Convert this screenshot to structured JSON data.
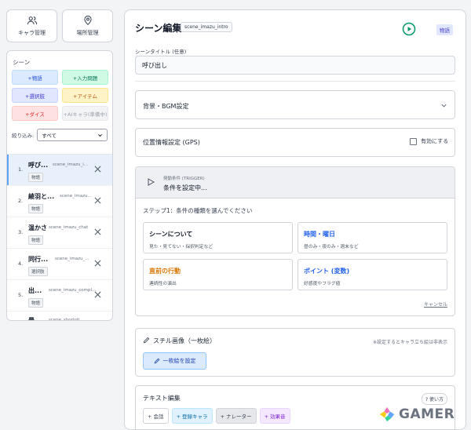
{
  "top_buttons": {
    "character": "キャラ管理",
    "location": "場所管理"
  },
  "scene_panel": {
    "title": "シーン",
    "add_buttons": {
      "story": "+物語",
      "input": "+入力問題",
      "choice": "+選択肢",
      "item": "+アイテム",
      "dice": "+ダイス",
      "ai": "+AIキャラ(準備中)"
    },
    "filter_label": "絞り込み:",
    "filter_value": "すべて",
    "scenes": [
      {
        "num": "1.",
        "title": "呼び...",
        "id": "scene_imazu_i...",
        "tag": "物語"
      },
      {
        "num": "2.",
        "title": "綾羽と...",
        "id": "scene_imazu...",
        "tag": "物語"
      },
      {
        "num": "3.",
        "title": "温かさ",
        "id": "scene_imazu_chat",
        "tag": "物語"
      },
      {
        "num": "4.",
        "title": "同行...",
        "id": "scene_imazu_...",
        "tag": "選択肢"
      },
      {
        "num": "5.",
        "title": "出...",
        "id": "scene_imazu_compl...",
        "tag": "物語"
      },
      {
        "num": "",
        "title": "最",
        "id": "scene_shorinti_...",
        "tag": ""
      }
    ]
  },
  "editor": {
    "title": "シーン編集",
    "scene_id": "scene_imazu_intro",
    "type_badge": "物語",
    "title_label": "シーンタイトル (任意)",
    "title_value": "呼び出し",
    "bgm_title": "背景・BGM設定",
    "gps_title": "位置情報設定 (GPS)",
    "gps_enable": "有効にする",
    "trigger": {
      "sub": "発動条件 (TRIGGER)",
      "main": "条件を設定中...",
      "step": "ステップ1：条件の種類を選んでください",
      "options": [
        {
          "title": "シーンについて",
          "desc": "見た・見てない・採択判定など"
        },
        {
          "title": "時間・曜日",
          "desc": "昼のみ・夜のみ・週末など"
        },
        {
          "title": "直前の行動",
          "desc": "連続性の演出"
        },
        {
          "title": "ポイント (変数)",
          "desc": "好感度やフラグ値"
        }
      ],
      "cancel": "キャンセル"
    },
    "still": {
      "title": "スチル画像（一枚絵）",
      "note": "※設定するとキャラ立ち絵は非表示",
      "button": "一枚絵を設定"
    },
    "text_edit": {
      "title": "テキスト編集",
      "help": "? 使い方",
      "buttons": [
        "+ 会話",
        "+ 登録キャラ",
        "+ ナレーター",
        "+ 効果音"
      ]
    }
  },
  "watermark": "GAMER"
}
